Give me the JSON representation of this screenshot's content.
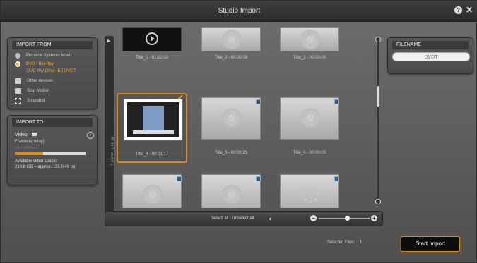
{
  "window": {
    "title": "Studio Import",
    "help_icon": "?",
    "close_icon": "✕"
  },
  "import_from": {
    "heading": "IMPORT FROM",
    "items": [
      {
        "label": "Pinnacle Systems Movi...",
        "icon": "disc-icon",
        "active": false
      },
      {
        "label": "DVD / Blu-Ray",
        "icon": "dvd-icon",
        "active": true
      },
      {
        "label": "DVD RW Drive (E:) DVDT",
        "icon": "",
        "active": true
      },
      {
        "label": "Other devices",
        "icon": "folder-icon",
        "active": false
      },
      {
        "label": "Stop Motion",
        "icon": "camera-icon",
        "active": false
      },
      {
        "label": "Snapshot",
        "icon": "snapshot-icon",
        "active": false
      }
    ]
  },
  "import_to": {
    "heading": "IMPORT TO",
    "video_label": "Video",
    "path": "F:\\video\\(today)",
    "subpath": "(set subfolder)",
    "space_label": "Available video space:",
    "space_value": "219.8 GB = approx. 156 h 49 mi",
    "space_fill_pct": 40
  },
  "tree_view_label": "TREE VIEW",
  "titles": [
    {
      "caption": "Title_1 - 01:32:02",
      "kind": "dark"
    },
    {
      "caption": "Title_2 - 00:00:08",
      "kind": "disc"
    },
    {
      "caption": "Title_3 - 00:00:00",
      "kind": "disc"
    },
    {
      "caption": "Title_4 - 00:01:17",
      "kind": "poster",
      "selected": true
    },
    {
      "caption": "Title_5 - 00:00:29",
      "kind": "disc"
    },
    {
      "caption": "Title_6 - 00:00:05",
      "kind": "disc"
    },
    {
      "caption": "",
      "kind": "disc"
    },
    {
      "caption": "",
      "kind": "disc"
    },
    {
      "caption": "",
      "kind": "flower"
    }
  ],
  "bottombar": {
    "select_all": "Select all",
    "separator": "|",
    "unselect_all": "Unselect all",
    "zoom_level": 0.55
  },
  "filename": {
    "heading": "FILENAME",
    "value": "DVDT"
  },
  "footer": {
    "selected_files_label": "Selected Files:",
    "selected_files_count": "1",
    "start_import": "Start Import"
  },
  "colors": {
    "accent": "#f5a623",
    "selected_border": "#d88a1e"
  }
}
